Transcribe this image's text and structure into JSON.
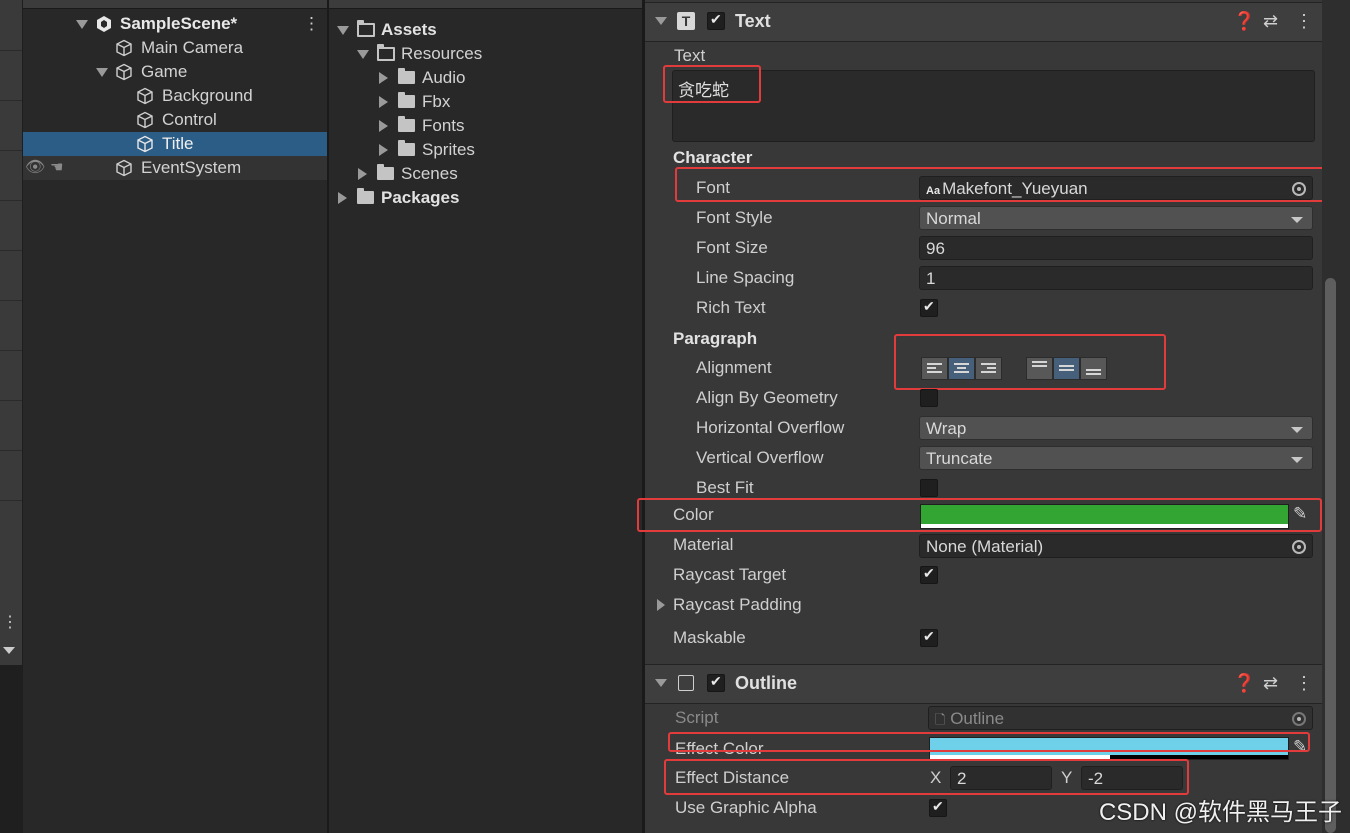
{
  "hierarchy": {
    "scene": "SampleScene*",
    "items": [
      {
        "label": "Main Camera"
      },
      {
        "label": "Game"
      },
      {
        "label": "Background"
      },
      {
        "label": "Control"
      },
      {
        "label": "Title"
      },
      {
        "label": "EventSystem"
      }
    ]
  },
  "project": {
    "items": [
      {
        "label": "Assets"
      },
      {
        "label": "Resources"
      },
      {
        "label": "Audio"
      },
      {
        "label": "Fbx"
      },
      {
        "label": "Fonts"
      },
      {
        "label": "Sprites"
      },
      {
        "label": "Scenes"
      },
      {
        "label": "Packages"
      }
    ]
  },
  "text_component": {
    "title": "Text",
    "text_label": "Text",
    "text_value": "贪吃蛇",
    "character_header": "Character",
    "font_label": "Font",
    "font_icon_text": "Aa",
    "font_value": "Makefont_Yueyuan",
    "font_style_label": "Font Style",
    "font_style_value": "Normal",
    "font_size_label": "Font Size",
    "font_size_value": "96",
    "line_spacing_label": "Line Spacing",
    "line_spacing_value": "1",
    "rich_text_label": "Rich Text",
    "rich_text_checked": true,
    "paragraph_header": "Paragraph",
    "alignment_label": "Alignment",
    "align_by_geometry_label": "Align By Geometry",
    "align_by_geometry_checked": false,
    "horizontal_overflow_label": "Horizontal Overflow",
    "horizontal_overflow_value": "Wrap",
    "vertical_overflow_label": "Vertical Overflow",
    "vertical_overflow_value": "Truncate",
    "best_fit_label": "Best Fit",
    "best_fit_checked": false,
    "color_label": "Color",
    "color_value": "#33a532",
    "material_label": "Material",
    "material_value": "None (Material)",
    "raycast_target_label": "Raycast Target",
    "raycast_target_checked": true,
    "raycast_padding_label": "Raycast Padding",
    "maskable_label": "Maskable",
    "maskable_checked": true
  },
  "outline_component": {
    "title": "Outline",
    "script_label": "Script",
    "script_value": "Outline",
    "effect_color_label": "Effect Color",
    "effect_color_value": "#6fd0ea",
    "effect_distance_label": "Effect Distance",
    "x_label": "X",
    "x_value": "2",
    "y_label": "Y",
    "y_value": "-2",
    "use_graphic_alpha_label": "Use Graphic Alpha",
    "use_graphic_alpha_checked": true
  },
  "icons": {
    "help": "help-icon",
    "presets": "presets-icon",
    "menu": "kebab-menu-icon",
    "eyedropper": "eyedropper-icon",
    "object_picker": "object-picker-icon",
    "visibility": "eye-icon",
    "pickable": "hand-icon"
  },
  "watermark": "CSDN @软件黑马王子"
}
